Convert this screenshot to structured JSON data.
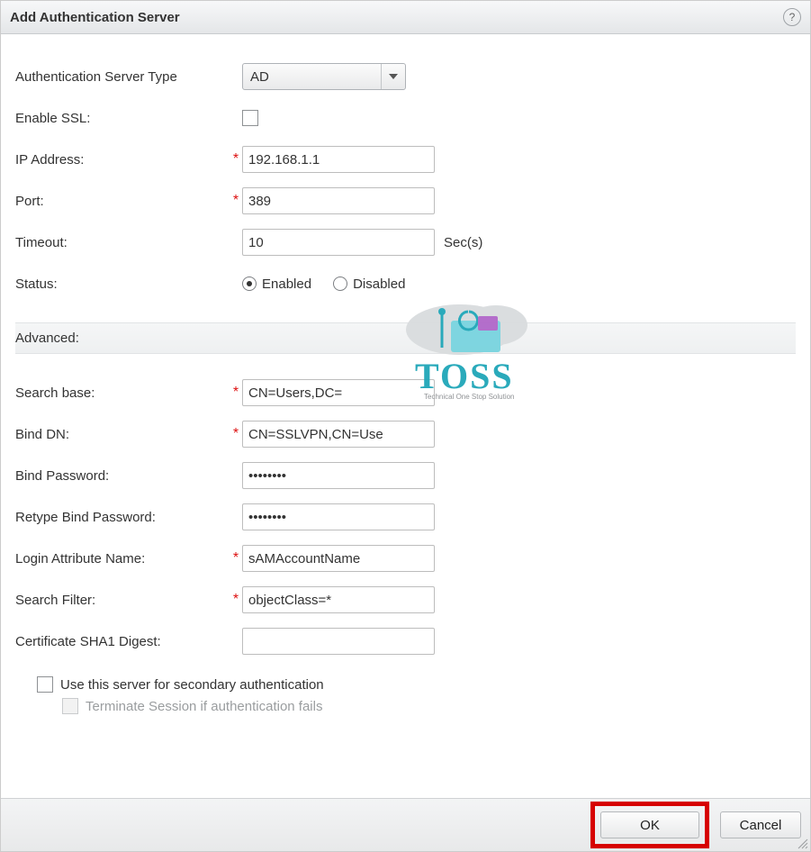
{
  "dialog": {
    "title": "Add Authentication Server"
  },
  "fields": {
    "server_type_label": "Authentication Server Type",
    "server_type_value": "AD",
    "enable_ssl_label": "Enable SSL:",
    "ip_label": "IP Address:",
    "ip_value": "192.168.1.1",
    "port_label": "Port:",
    "port_value": "389",
    "timeout_label": "Timeout:",
    "timeout_value": "10",
    "timeout_unit": "Sec(s)",
    "status_label": "Status:",
    "status_enabled": "Enabled",
    "status_disabled": "Disabled",
    "status_value": "enabled"
  },
  "advanced": {
    "heading": "Advanced:",
    "search_base_label": "Search base:",
    "search_base_value": "CN=Users,DC=",
    "bind_dn_label": "Bind DN:",
    "bind_dn_value": "CN=SSLVPN,CN=Use",
    "bind_pw_label": "Bind Password:",
    "bind_pw_value": "********",
    "retype_pw_label": "Retype Bind Password:",
    "retype_pw_value": "********",
    "login_attr_label": "Login Attribute Name:",
    "login_attr_value": "sAMAccountName",
    "search_filter_label": "Search Filter:",
    "search_filter_value": "objectClass=*",
    "cert_sha1_label": "Certificate SHA1 Digest:",
    "cert_sha1_value": ""
  },
  "secondary": {
    "use_label": "Use this server for secondary authentication",
    "terminate_label": "Terminate Session if authentication fails"
  },
  "buttons": {
    "ok": "OK",
    "cancel": "Cancel"
  },
  "watermark": {
    "brand": "TOSS",
    "tagline": "Technical One Stop Solution"
  }
}
